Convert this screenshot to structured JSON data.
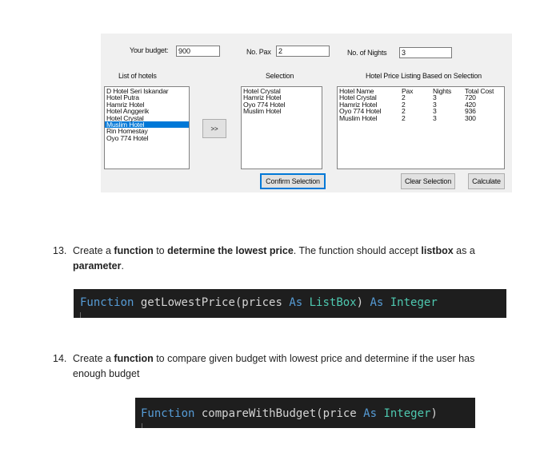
{
  "form": {
    "budget_label": "Your budget:",
    "budget_value": "900",
    "pax_label": "No. Pax",
    "pax_value": "2",
    "nights_label": "No. of Nights",
    "nights_value": "3",
    "hotels_label": "List of hotels",
    "selection_label": "Selection",
    "price_listing_label": "Hotel Price Listing Based on Selection",
    "hotels": [
      "D Hotel Seri Iskandar",
      "Hotel Putra",
      "Hamriz Hotel",
      "Hotel Anggerik",
      "Hotel Crystal",
      "Muslim Hotel",
      "Rin Homestay",
      "Oyo 774 Hotel"
    ],
    "selected_hotel": "Muslim Hotel",
    "transfer_button": ">>",
    "selection": [
      "Hotel Crystal",
      "Hamriz Hotel",
      "Oyo 774 Hotel",
      "Muslim Hotel"
    ],
    "price_headers": [
      "Hotel Name",
      "Pax",
      "Nights",
      "Total Cost"
    ],
    "price_rows": [
      [
        "Hotel Crystal",
        "2",
        "3",
        "720"
      ],
      [
        "Hamriz Hotel",
        "2",
        "3",
        "420"
      ],
      [
        "Oyo 774 Hotel",
        "2",
        "3",
        "936"
      ],
      [
        "Muslim Hotel",
        "2",
        "3",
        "300"
      ]
    ],
    "confirm_button": "Confirm Selection",
    "clear_button": "Clear Selection",
    "calculate_button": "Calculate"
  },
  "doc": {
    "q13_num": "13.",
    "q13_p1": "Create a ",
    "q13_b1": "function",
    "q13_p2": " to ",
    "q13_b2": "determine the lowest price",
    "q13_p3": ". The function should accept ",
    "q13_b3": "listbox",
    "q13_p4": " as a",
    "q13_b4": "parameter",
    "q13_p5": ".",
    "code1_kw1": "Function",
    "code1_name": " getLowestPrice(prices ",
    "code1_kw2": "As",
    "code1_type": " ListBox",
    "code1_close": ") ",
    "code1_kw3": "As",
    "code1_type2": " Integer",
    "q14_num": "14.",
    "q14_p1": "Create a ",
    "q14_b1": "function",
    "q14_p2": " to compare given budget with lowest price and determine if the user has",
    "q14_line2": "enough budget",
    "code2_kw1": "Function",
    "code2_name": " compareWithBudget(price ",
    "code2_kw2": "As",
    "code2_type": " Integer",
    "code2_close": ")"
  }
}
